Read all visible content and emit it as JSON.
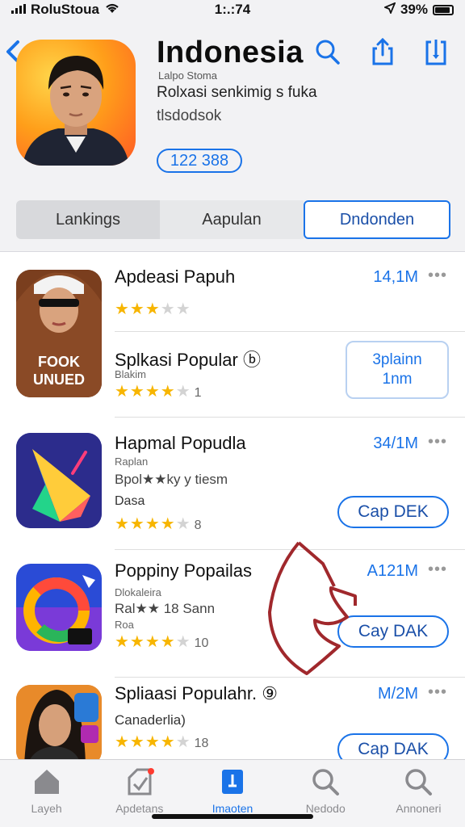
{
  "status_bar": {
    "carrier": "RoluStoua",
    "time": "1:.:74",
    "battery": "39%"
  },
  "header": {
    "back_icon": "chevron-left-icon",
    "title": "Indonesia",
    "subtitle_small": "Lalpo Stoma",
    "subtitle_line1": "Rolxasi senkimig s fuka",
    "subtitle_line2": "tlsdodsok",
    "count": "122 388",
    "icons": [
      "search-icon",
      "share-icon",
      "download-icon"
    ]
  },
  "segments": [
    "Lankings",
    "Aapulan",
    "Dndonden"
  ],
  "items": [
    {
      "title": "Apdeasi Papuh",
      "size": "14,1M",
      "rating": 3,
      "rating_count": "",
      "more": "•••"
    },
    {
      "title": "Splkasi Popular",
      "badge": "ⓑ",
      "sub": "Blakim",
      "rating": 4,
      "rating_count": "1",
      "button_line1": "3plainn",
      "button_line2": "1nm",
      "icon_text_line1": "FOOK",
      "icon_text_line2": "UNUED"
    },
    {
      "title": "Hapmal Popudla",
      "size": "34/1M",
      "more": "•••",
      "sub": "Raplan",
      "sub2": "Bpol★★ky y tiesm",
      "sub3": "Dasa",
      "rating": 4,
      "rating_count": "8",
      "button": "Cap DEK"
    },
    {
      "title": "Poppiny Popailas",
      "size": "A121M",
      "more": "•••",
      "sub": "Dlokaleira",
      "sub2": "Ral★★ 18 Sann",
      "sub3": "Roa",
      "rating": 4,
      "rating_count": "10",
      "button": "Cay DAK"
    },
    {
      "title": "Spliaasi Populahr.",
      "badge": "⑨",
      "size": "M/2M",
      "more": "•••",
      "sub": "Canaderlia)",
      "rating": 4,
      "rating_count": "18",
      "button": "Cap DAK"
    }
  ],
  "tabs": [
    {
      "label": "Layeh",
      "icon": "home-icon"
    },
    {
      "label": "Apdetans",
      "icon": "updates-icon"
    },
    {
      "label": "Imaoten",
      "icon": "featured-icon"
    },
    {
      "label": "Nedodo",
      "icon": "search-icon"
    },
    {
      "label": "Annoneri",
      "icon": "search-icon"
    }
  ],
  "colors": {
    "accent": "#1a73e8",
    "star": "#f7b500",
    "star_off": "#d3d3d3"
  }
}
